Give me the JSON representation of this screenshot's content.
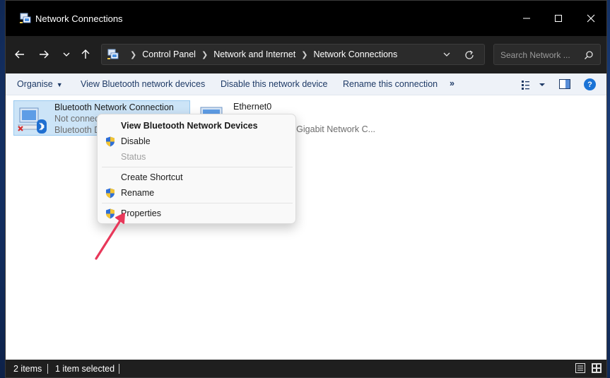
{
  "window": {
    "title": "Network Connections",
    "controls": {
      "minimize": "minimize-icon",
      "maximize": "maximize-icon",
      "close": "close-icon"
    }
  },
  "nav": {
    "breadcrumbs": [
      "Control Panel",
      "Network and Internet",
      "Network Connections"
    ],
    "search_placeholder": "Search Network ..."
  },
  "toolbar": {
    "organise": "Organise",
    "view_bluetooth": "View Bluetooth network devices",
    "disable": "Disable this network device",
    "rename": "Rename this connection",
    "more": "»"
  },
  "items": [
    {
      "title": "Bluetooth Network Connection",
      "status": "Not connected",
      "device": "Bluetooth Device (Personal Area Network)",
      "selected": true,
      "icon": "bluetooth-network-adapter-icon"
    },
    {
      "title": "Ethernet0",
      "status": "",
      "device": "Intel(R) 82574L Gigabit Network C...",
      "selected": false,
      "icon": "ethernet-adapter-icon"
    }
  ],
  "context_menu": {
    "view_devices": "View Bluetooth Network Devices",
    "disable": "Disable",
    "status": "Status",
    "create_shortcut": "Create Shortcut",
    "rename": "Rename",
    "properties": "Properties"
  },
  "statusbar": {
    "count": "2 items",
    "selected": "1 item selected"
  },
  "colors": {
    "titlebar": "#000000",
    "navbar": "#1f1f1f",
    "selection": "#cce4f7",
    "accent_arrow": "#e8385a"
  }
}
